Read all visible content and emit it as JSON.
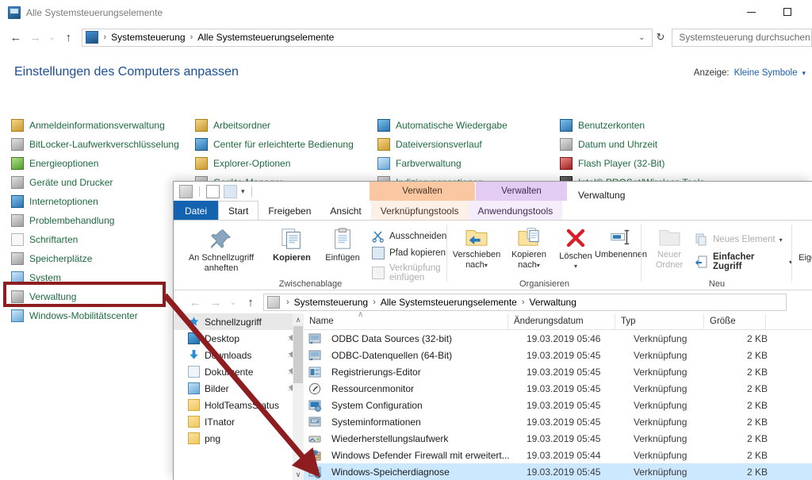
{
  "control_panel": {
    "window_title": "Alle Systemsteuerungselemente",
    "window_icon": "control-panel-icon",
    "minimize_label": "—",
    "maximize_label": "□",
    "nav": {
      "back": "←",
      "forward": "→",
      "history": "⌄",
      "up": "↑"
    },
    "address": {
      "icon": "control-panel-icon",
      "crumbs": [
        "Systemsteuerung",
        "Alle Systemsteuerungselemente"
      ],
      "separator": "›",
      "dropdown_caret": "⌄",
      "refresh": "↻"
    },
    "search_placeholder": "Systemsteuerung durchsuchen",
    "heading": "Einstellungen des Computers anpassen",
    "view": {
      "label": "Anzeige:",
      "value": "Kleine Symbole",
      "caret": "▾"
    },
    "columns": [
      {
        "items": [
          {
            "label": "Anmeldeinformationsverwaltung",
            "icon": "credentials-icon",
            "style": "ic-gold"
          },
          {
            "label": "BitLocker-Laufwerkverschlüsselung",
            "icon": "bitlocker-icon",
            "style": "ic-grey"
          },
          {
            "label": "Energieoptionen",
            "icon": "power-options-icon",
            "style": "ic-green"
          },
          {
            "label": "Geräte und Drucker",
            "icon": "devices-printers-icon",
            "style": "ic-grey"
          },
          {
            "label": "Internetoptionen",
            "icon": "internet-options-icon",
            "style": "ic-blue"
          },
          {
            "label": "Problembehandlung",
            "icon": "troubleshooting-icon",
            "style": "ic-grey"
          },
          {
            "label": "Schriftarten",
            "icon": "fonts-icon",
            "style": "ic-white"
          },
          {
            "label": "Speicherplätze",
            "icon": "storage-spaces-icon",
            "style": "ic-grey"
          },
          {
            "label": "System",
            "icon": "system-icon",
            "style": "ic-mon"
          },
          {
            "label": "Verwaltung",
            "icon": "administrative-tools-icon",
            "style": "ic-grey"
          },
          {
            "label": "Windows-Mobilitätscenter",
            "icon": "mobility-center-icon",
            "style": "ic-mon"
          }
        ]
      },
      {
        "items": [
          {
            "label": "Arbeitsordner",
            "icon": "work-folders-icon",
            "style": "ic-gold"
          },
          {
            "label": "Center für erleichterte Bedienung",
            "icon": "ease-of-access-icon",
            "style": "ic-blue"
          },
          {
            "label": "Explorer-Optionen",
            "icon": "explorer-options-icon",
            "style": "ic-gold"
          },
          {
            "label": "Geräte-Manager",
            "icon": "device-manager-icon",
            "style": "ic-grey"
          }
        ]
      },
      {
        "items": [
          {
            "label": "Automatische Wiedergabe",
            "icon": "autoplay-icon",
            "style": "ic-blue"
          },
          {
            "label": "Dateiversionsverlauf",
            "icon": "file-history-icon",
            "style": "ic-gold"
          },
          {
            "label": "Farbverwaltung",
            "icon": "color-management-icon",
            "style": "ic-mon"
          },
          {
            "label": "Indizierungsoptionen",
            "icon": "indexing-options-icon",
            "style": "ic-grey"
          }
        ]
      },
      {
        "items": [
          {
            "label": "Benutzerkonten",
            "icon": "user-accounts-icon",
            "style": "ic-blue"
          },
          {
            "label": "Datum und Uhrzeit",
            "icon": "date-time-icon",
            "style": "ic-grey"
          },
          {
            "label": "Flash Player (32-Bit)",
            "icon": "flash-player-icon",
            "style": "ic-red"
          },
          {
            "label": "Intel® PROSet/Wireless Tools",
            "icon": "intel-proset-icon",
            "style": "ic-dark"
          }
        ]
      }
    ],
    "highlight": {
      "target_label": "Verwaltung",
      "color": "#8e1d20"
    }
  },
  "explorer": {
    "window_title": "Verwaltung",
    "quick_access": {
      "icon": "administrative-tools-icon",
      "properties_icon": "properties-icon",
      "new_folder_icon": "new-folder-icon",
      "caret": "▾"
    },
    "contextual_tabs": [
      {
        "banner": "Verwalten",
        "tab": "Verknüpfungstools",
        "color": "#f9c7a2"
      },
      {
        "banner": "Verwalten",
        "tab": "Anwendungstools",
        "color": "#e3ccf3"
      }
    ],
    "tabs": [
      {
        "label": "Datei",
        "state": "file"
      },
      {
        "label": "Start",
        "state": "active"
      },
      {
        "label": "Freigeben",
        "state": "normal"
      },
      {
        "label": "Ansicht",
        "state": "normal"
      }
    ],
    "ribbon": {
      "groups": [
        {
          "name": "Zwischenablage",
          "big_buttons": [
            {
              "label": "An Schnellzugriff\nanheften",
              "icon": "pin-icon"
            },
            {
              "label": "Kopieren",
              "icon": "copy-icon"
            },
            {
              "label": "Einfügen",
              "icon": "paste-icon"
            }
          ],
          "small_buttons": [
            {
              "label": "Ausschneiden",
              "icon": "scissors-icon",
              "disabled": false
            },
            {
              "label": "Pfad kopieren",
              "icon": "copy-path-icon",
              "disabled": false
            },
            {
              "label": "Verknüpfung einfügen",
              "icon": "paste-shortcut-icon",
              "disabled": true
            }
          ]
        },
        {
          "name": "Organisieren",
          "big_buttons": [
            {
              "label": "Verschieben\nnach",
              "icon": "move-to-icon",
              "caret": "▾"
            },
            {
              "label": "Kopieren\nnach",
              "icon": "copy-to-icon",
              "caret": "▾"
            },
            {
              "label": "Löschen",
              "icon": "delete-icon",
              "caret": "▾"
            },
            {
              "label": "Umbenennen",
              "icon": "rename-icon"
            }
          ]
        },
        {
          "name": "Neu",
          "big_buttons": [
            {
              "label": "Neuer\nOrdner",
              "icon": "new-folder-icon",
              "disabled": true
            }
          ],
          "small_buttons": [
            {
              "label": "Neues Element",
              "icon": "new-item-icon",
              "caret": "▾",
              "disabled": true
            },
            {
              "label": "Einfacher Zugriff",
              "icon": "easy-access-icon",
              "caret": "▾",
              "disabled": false
            }
          ]
        },
        {
          "name": "",
          "big_buttons": [
            {
              "label": "Eigenschaften",
              "icon": "properties-icon",
              "caret": "▾"
            }
          ]
        }
      ]
    },
    "nav": {
      "back": "←",
      "forward": "→",
      "history": "⌄",
      "up": "↑",
      "crumbs": [
        "Systemsteuerung",
        "Alle Systemsteuerungselemente",
        "Verwaltung"
      ],
      "separator": "›",
      "icon": "administrative-tools-icon"
    },
    "sidebar": {
      "items": [
        {
          "label": "Schnellzugriff",
          "icon": "quick-access-star-icon",
          "selected": true,
          "pinned": false
        },
        {
          "label": "Desktop",
          "icon": "desktop-icon",
          "selected": false,
          "pinned": true
        },
        {
          "label": "Downloads",
          "icon": "downloads-icon",
          "selected": false,
          "pinned": true
        },
        {
          "label": "Dokumente",
          "icon": "documents-icon",
          "selected": false,
          "pinned": true
        },
        {
          "label": "Bilder",
          "icon": "pictures-icon",
          "selected": false,
          "pinned": true
        },
        {
          "label": "HoldTeamsStatus",
          "icon": "folder-icon",
          "selected": false,
          "pinned": false
        },
        {
          "label": "ITnator",
          "icon": "folder-icon",
          "selected": false,
          "pinned": false
        },
        {
          "label": "png",
          "icon": "folder-icon",
          "selected": false,
          "pinned": false
        }
      ],
      "scroll_up": "∧",
      "scroll_down": "∨"
    },
    "list": {
      "headers": [
        "Name",
        "Änderungsdatum",
        "Typ",
        "Größe"
      ],
      "sort_indicator": "∧",
      "rows": [
        {
          "name": "ODBC Data Sources (32-bit)",
          "modified": "19.03.2019 05:46",
          "type": "Verknüpfung",
          "size": "2 KB",
          "icon": "odbc-icon",
          "selected": false
        },
        {
          "name": "ODBC-Datenquellen (64-Bit)",
          "modified": "19.03.2019 05:45",
          "type": "Verknüpfung",
          "size": "2 KB",
          "icon": "odbc-icon",
          "selected": false
        },
        {
          "name": "Registrierungs-Editor",
          "modified": "19.03.2019 05:45",
          "type": "Verknüpfung",
          "size": "2 KB",
          "icon": "regedit-icon",
          "selected": false
        },
        {
          "name": "Ressourcenmonitor",
          "modified": "19.03.2019 05:45",
          "type": "Verknüpfung",
          "size": "2 KB",
          "icon": "resource-monitor-icon",
          "selected": false
        },
        {
          "name": "System Configuration",
          "modified": "19.03.2019 05:45",
          "type": "Verknüpfung",
          "size": "2 KB",
          "icon": "msconfig-icon",
          "selected": false
        },
        {
          "name": "Systeminformationen",
          "modified": "19.03.2019 05:45",
          "type": "Verknüpfung",
          "size": "2 KB",
          "icon": "msinfo-icon",
          "selected": false
        },
        {
          "name": "Wiederherstellungslaufwerk",
          "modified": "19.03.2019 05:45",
          "type": "Verknüpfung",
          "size": "2 KB",
          "icon": "recovery-drive-icon",
          "selected": false
        },
        {
          "name": "Windows Defender Firewall mit erweitert...",
          "modified": "19.03.2019 05:44",
          "type": "Verknüpfung",
          "size": "2 KB",
          "icon": "firewall-icon",
          "selected": false
        },
        {
          "name": "Windows-Speicherdiagnose",
          "modified": "19.03.2019 05:45",
          "type": "Verknüpfung",
          "size": "2 KB",
          "icon": "memory-diagnostic-icon",
          "selected": true
        }
      ]
    }
  }
}
